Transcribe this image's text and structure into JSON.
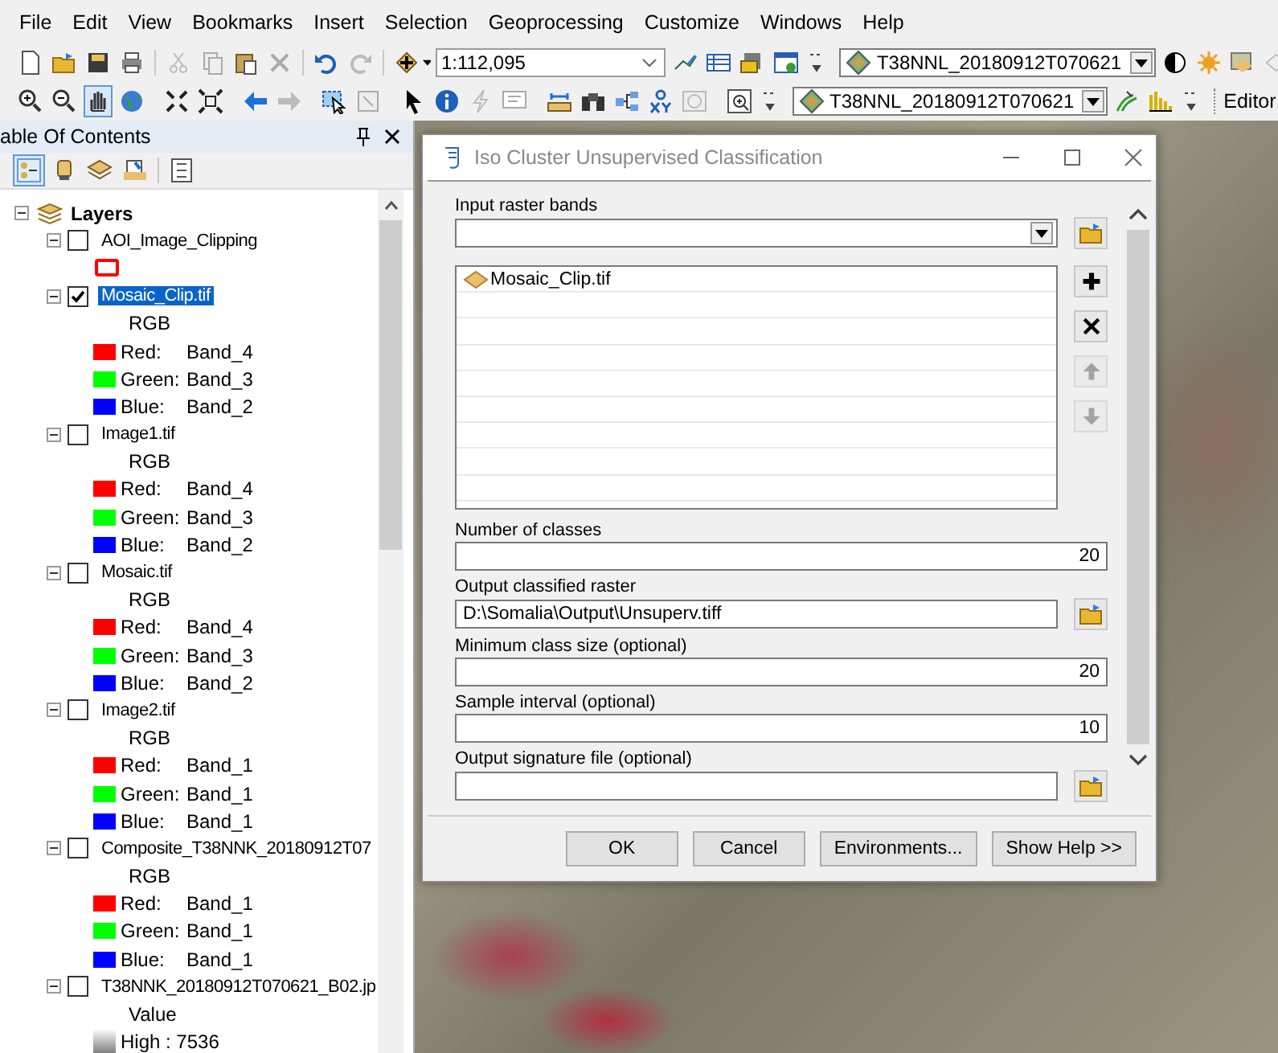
{
  "menu": [
    "File",
    "Edit",
    "View",
    "Bookmarks",
    "Insert",
    "Selection",
    "Geoprocessing",
    "Customize",
    "Windows",
    "Help"
  ],
  "toolbar": {
    "scale": "1:112,095",
    "layer_combo_1": "T38NNL_20180912T070621",
    "layer_combo_2": "T38NNL_20180912T070621",
    "editor_menu": "Editor"
  },
  "toc": {
    "title": "able Of Contents",
    "root": {
      "label": "Layers",
      "expanded": true,
      "children": [
        {
          "name": "AOI_Image_Clipping",
          "checked": false,
          "selected": false,
          "expanded": true,
          "legend": [
            {
              "kind": "outline",
              "color": "#ff0000"
            }
          ]
        },
        {
          "name": "Mosaic_Clip.tif",
          "checked": true,
          "selected": true,
          "expanded": true,
          "legend": [
            {
              "kind": "heading",
              "text": "RGB"
            },
            {
              "kind": "band",
              "color": "#ff0000",
              "channel": "Red:",
              "band": "Band_4"
            },
            {
              "kind": "band",
              "color": "#00ff00",
              "channel": "Green:",
              "band": "Band_3"
            },
            {
              "kind": "band",
              "color": "#0000ff",
              "channel": "Blue:",
              "band": "Band_2"
            }
          ]
        },
        {
          "name": "Image1.tif",
          "checked": false,
          "selected": false,
          "expanded": true,
          "legend": [
            {
              "kind": "heading",
              "text": "RGB"
            },
            {
              "kind": "band",
              "color": "#ff0000",
              "channel": "Red:",
              "band": "Band_4"
            },
            {
              "kind": "band",
              "color": "#00ff00",
              "channel": "Green:",
              "band": "Band_3"
            },
            {
              "kind": "band",
              "color": "#0000ff",
              "channel": "Blue:",
              "band": "Band_2"
            }
          ]
        },
        {
          "name": "Mosaic.tif",
          "checked": false,
          "selected": false,
          "expanded": true,
          "legend": [
            {
              "kind": "heading",
              "text": "RGB"
            },
            {
              "kind": "band",
              "color": "#ff0000",
              "channel": "Red:",
              "band": "Band_4"
            },
            {
              "kind": "band",
              "color": "#00ff00",
              "channel": "Green:",
              "band": "Band_3"
            },
            {
              "kind": "band",
              "color": "#0000ff",
              "channel": "Blue:",
              "band": "Band_2"
            }
          ]
        },
        {
          "name": "Image2.tif",
          "checked": false,
          "selected": false,
          "expanded": true,
          "legend": [
            {
              "kind": "heading",
              "text": "RGB"
            },
            {
              "kind": "band",
              "color": "#ff0000",
              "channel": "Red:",
              "band": "Band_1"
            },
            {
              "kind": "band",
              "color": "#00ff00",
              "channel": "Green:",
              "band": "Band_1"
            },
            {
              "kind": "band",
              "color": "#0000ff",
              "channel": "Blue:",
              "band": "Band_1"
            }
          ]
        },
        {
          "name": "Composite_T38NNK_20180912T07",
          "checked": false,
          "selected": false,
          "expanded": true,
          "legend": [
            {
              "kind": "heading",
              "text": "RGB"
            },
            {
              "kind": "band",
              "color": "#ff0000",
              "channel": "Red:",
              "band": "Band_1"
            },
            {
              "kind": "band",
              "color": "#00ff00",
              "channel": "Green:",
              "band": "Band_1"
            },
            {
              "kind": "band",
              "color": "#0000ff",
              "channel": "Blue:",
              "band": "Band_1"
            }
          ]
        },
        {
          "name": "T38NNK_20180912T070621_B02.jp",
          "checked": false,
          "selected": false,
          "expanded": true,
          "legend": [
            {
              "kind": "heading",
              "text": "Value"
            },
            {
              "kind": "ramp",
              "text": "High : 7536"
            }
          ]
        }
      ]
    }
  },
  "dialog": {
    "title": "Iso Cluster Unsupervised Classification",
    "fields": [
      {
        "kind": "combo",
        "label": "Input raster bands",
        "browse": true
      },
      {
        "kind": "list",
        "items": [
          {
            "name": "Mosaic_Clip.tif"
          }
        ],
        "buttons": [
          {
            "kind": "add",
            "disabled": false
          },
          {
            "kind": "remove",
            "disabled": false
          },
          {
            "kind": "up",
            "disabled": true
          },
          {
            "kind": "down",
            "disabled": true
          }
        ]
      },
      {
        "kind": "number",
        "label": "Number of classes",
        "value": "20"
      },
      {
        "kind": "path",
        "label": "Output classified raster",
        "value": "D:\\Somalia\\Output\\Unsuperv.tiff",
        "browse": true
      },
      {
        "kind": "number",
        "label": "Minimum class size (optional)",
        "value": "20"
      },
      {
        "kind": "number",
        "label": "Sample interval (optional)",
        "value": "10"
      },
      {
        "kind": "path",
        "label": "Output signature file (optional)",
        "browse": true
      }
    ],
    "buttons": [
      "OK",
      "Cancel",
      "Environments...",
      "Show Help >>"
    ]
  }
}
